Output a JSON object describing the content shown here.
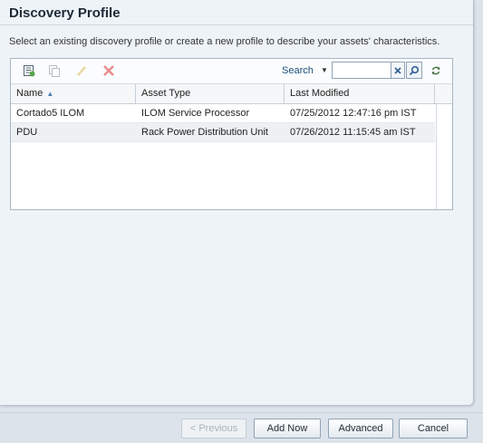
{
  "dialog": {
    "title": "Discovery Profile",
    "description": "Select an existing discovery profile or create a new profile to describe your assets' characteristics."
  },
  "toolbar": {
    "icons": [
      "new-profile-icon",
      "copy-icon",
      "edit-icon",
      "delete-icon"
    ],
    "search_label": "Search",
    "search_value": "",
    "clear_icon": "close-icon",
    "go_icon": "magnifier-icon",
    "refresh_icon": "refresh-icon"
  },
  "table": {
    "columns": [
      "Name",
      "Asset Type",
      "Last Modified"
    ],
    "sort_column": "Name",
    "rows": [
      {
        "name": "Cortado5 ILOM",
        "asset_type": "ILOM Service Processor",
        "last_modified": "07/25/2012 12:47:16 pm IST"
      },
      {
        "name": "PDU",
        "asset_type": "Rack Power Distribution Unit",
        "last_modified": "07/26/2012 11:15:45 am IST"
      }
    ]
  },
  "footer": {
    "previous_label": "< Previous",
    "add_now_label": "Add Now",
    "advanced_label": "Advanced",
    "cancel_label": "Cancel"
  },
  "colors": {
    "accent": "#1d4f7a",
    "delete": "#e05a5a",
    "panel_bg": "#eef3f8"
  }
}
